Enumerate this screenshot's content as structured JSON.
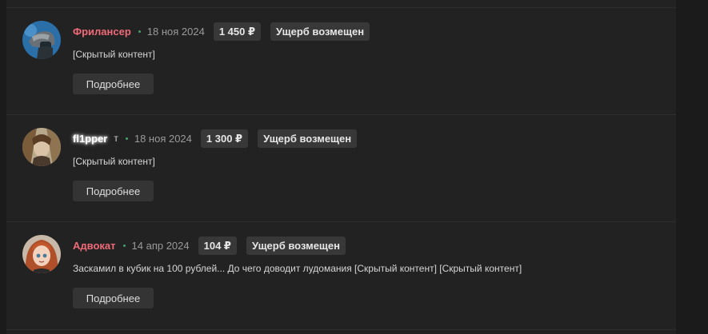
{
  "entries": [
    {
      "user": "Фрилансер",
      "user_suffix": "",
      "date": "18 ноя 2024",
      "amount": "1 450 ₽",
      "status": "Ущерб возмещен",
      "content": "[Скрытый контент]",
      "button": "Подробнее"
    },
    {
      "user": "fl1pper",
      "user_suffix": "т",
      "date": "18 ноя 2024",
      "amount": "1 300 ₽",
      "status": "Ущерб возмещен",
      "content": "[Скрытый контент]",
      "button": "Подробнее"
    },
    {
      "user": "Адвокат",
      "user_suffix": "",
      "date": "14 апр 2024",
      "amount": "104 ₽",
      "status": "Ущерб возмещен",
      "content": "Заскамил в кубик на 100 рублей... До чего доводит лудомания [Скрытый контент] [Скрытый контент]",
      "button": "Подробнее"
    }
  ],
  "colors": {
    "username_red": "#f06a78",
    "online_dot": "#3fa36b",
    "chip_bg": "#383838",
    "panel_bg": "#222222"
  }
}
